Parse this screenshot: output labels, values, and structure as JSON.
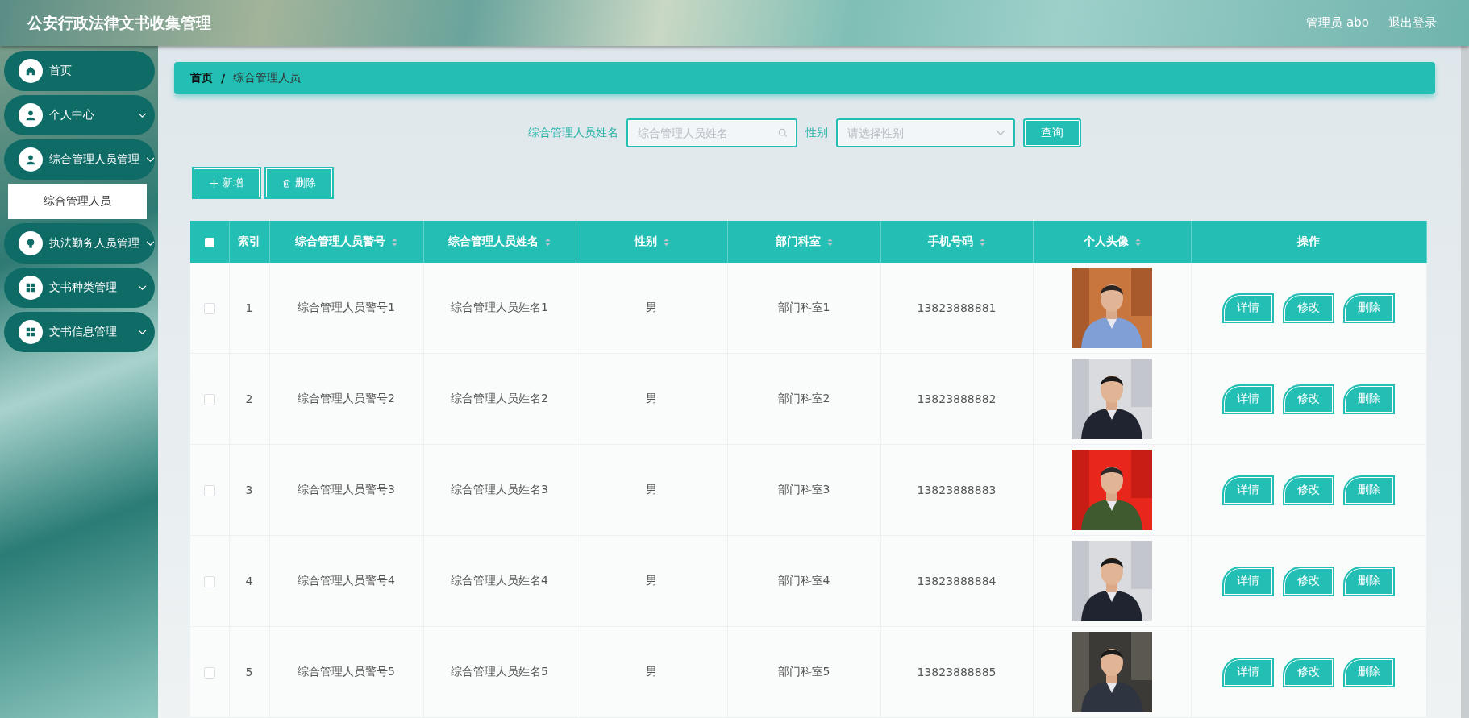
{
  "header": {
    "title": "公安行政法律文书收集管理",
    "user": "管理员 abo",
    "logout": "退出登录"
  },
  "sidebar": {
    "items": [
      {
        "label": "首页",
        "has_submenu": false
      },
      {
        "label": "个人中心",
        "has_submenu": true
      },
      {
        "label": "综合管理人员管理",
        "has_submenu": true,
        "children": [
          {
            "label": "综合管理人员",
            "selected": true
          }
        ]
      },
      {
        "label": "执法勤务人员管理",
        "has_submenu": true
      },
      {
        "label": "文书种类管理",
        "has_submenu": true
      },
      {
        "label": "文书信息管理",
        "has_submenu": true
      }
    ]
  },
  "breadcrumb": {
    "items": [
      "首页",
      "综合管理人员"
    ],
    "separator": "/"
  },
  "search": {
    "name_label": "综合管理人员姓名",
    "name_placeholder": "综合管理人员姓名",
    "gender_label": "性别",
    "gender_placeholder": "请选择性别",
    "query_button": "查询"
  },
  "toolbar": {
    "add_button": "新增",
    "delete_button": "删除"
  },
  "table": {
    "select_all_checked": false,
    "columns": [
      {
        "label": "索引",
        "sortable": false
      },
      {
        "label": "综合管理人员警号",
        "sortable": true
      },
      {
        "label": "综合管理人员姓名",
        "sortable": true
      },
      {
        "label": "性别",
        "sortable": true
      },
      {
        "label": "部门科室",
        "sortable": true
      },
      {
        "label": "手机号码",
        "sortable": true
      },
      {
        "label": "个人头像",
        "sortable": true
      },
      {
        "label": "操作",
        "sortable": false
      }
    ],
    "rows": [
      {
        "selected": false,
        "index": "1",
        "badge_no": "综合管理人员警号1",
        "name": "综合管理人员姓名1",
        "gender": "男",
        "department": "部门科室1",
        "phone": "13823888881",
        "actions": [
          "详情",
          "修改",
          "删除"
        ]
      },
      {
        "selected": false,
        "index": "2",
        "badge_no": "综合管理人员警号2",
        "name": "综合管理人员姓名2",
        "gender": "男",
        "department": "部门科室2",
        "phone": "13823888882",
        "actions": [
          "详情",
          "修改",
          "删除"
        ]
      },
      {
        "selected": false,
        "index": "3",
        "badge_no": "综合管理人员警号3",
        "name": "综合管理人员姓名3",
        "gender": "男",
        "department": "部门科室3",
        "phone": "13823888883",
        "actions": [
          "详情",
          "修改",
          "删除"
        ]
      },
      {
        "selected": false,
        "index": "4",
        "badge_no": "综合管理人员警号4",
        "name": "综合管理人员姓名4",
        "gender": "男",
        "department": "部门科室4",
        "phone": "13823888884",
        "actions": [
          "详情",
          "修改",
          "删除"
        ]
      },
      {
        "selected": false,
        "index": "5",
        "badge_no": "综合管理人员警号5",
        "name": "综合管理人员姓名5",
        "gender": "男",
        "department": "部门科室5",
        "phone": "13823888885",
        "actions": [
          "详情",
          "修改",
          "删除"
        ]
      }
    ]
  }
}
